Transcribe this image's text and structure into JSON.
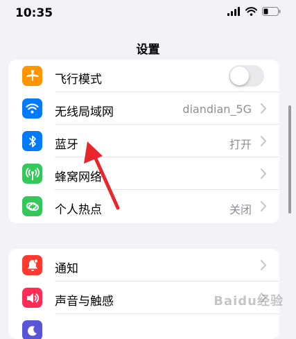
{
  "status_bar": {
    "time": "10:35"
  },
  "header": {
    "title": "设置"
  },
  "settings_group_1": [
    {
      "label": "飞行模式",
      "value": "",
      "icon": "airplane-icon",
      "icon_color": "#ff9500",
      "control": "toggle",
      "toggle_on": false
    },
    {
      "label": "无线局域网",
      "value": "diandian_5G",
      "icon": "wifi-icon",
      "icon_color": "#007aff",
      "control": "chevron"
    },
    {
      "label": "蓝牙",
      "value": "打开",
      "icon": "bluetooth-icon",
      "icon_color": "#007aff",
      "control": "chevron"
    },
    {
      "label": "蜂窝网络",
      "value": "",
      "icon": "cellular-icon",
      "icon_color": "#34c759",
      "control": "chevron"
    },
    {
      "label": "个人热点",
      "value": "关闭",
      "icon": "hotspot-icon",
      "icon_color": "#34c759",
      "control": "chevron"
    }
  ],
  "settings_group_2": [
    {
      "label": "通知",
      "value": "",
      "icon": "bell-icon",
      "icon_color": "#ff3b30",
      "control": "chevron"
    },
    {
      "label": "声音与触感",
      "value": "",
      "icon": "speaker-icon",
      "icon_color": "#ff2d55",
      "control": "chevron"
    },
    {
      "label": "",
      "value": "",
      "icon": "moon-icon",
      "icon_color": "#5856d6",
      "control": "chevron"
    }
  ],
  "annotation": {
    "color": "#e8262b"
  },
  "watermark": {
    "text": "Baidu经验"
  }
}
